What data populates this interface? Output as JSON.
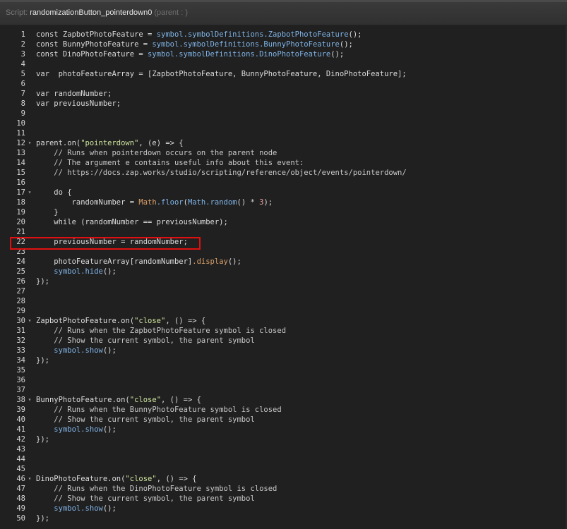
{
  "header": {
    "label": "Script:",
    "name": "randomizationButton_pointerdown0",
    "parent": "(parent : )"
  },
  "lines": [
    {
      "n": "1",
      "t": "const ZapbotPhotoFeature = symbol.symbolDefinitions.ZapbotPhotoFeature();"
    },
    {
      "n": "2",
      "t": "const BunnyPhotoFeature = symbol.symbolDefinitions.BunnyPhotoFeature();"
    },
    {
      "n": "3",
      "t": "const DinoPhotoFeature = symbol.symbolDefinitions.DinoPhotoFeature();"
    },
    {
      "n": "4",
      "t": ""
    },
    {
      "n": "5",
      "t": "var  photoFeatureArray = [ZapbotPhotoFeature, BunnyPhotoFeature, DinoPhotoFeature];"
    },
    {
      "n": "6",
      "t": ""
    },
    {
      "n": "7",
      "t": "var randomNumber;"
    },
    {
      "n": "8",
      "t": "var previousNumber;"
    },
    {
      "n": "9",
      "t": ""
    },
    {
      "n": "10",
      "t": ""
    },
    {
      "n": "11",
      "t": ""
    },
    {
      "n": "12",
      "t": "parent.on(\"pointerdown\", (e) => {"
    },
    {
      "n": "13",
      "t": "    // Runs when pointerdown occurs on the parent node"
    },
    {
      "n": "14",
      "t": "    // The argument e contains useful info about this event:"
    },
    {
      "n": "15",
      "t": "    // https://docs.zap.works/studio/scripting/reference/object/events/pointerdown/"
    },
    {
      "n": "16",
      "t": ""
    },
    {
      "n": "17",
      "t": "    do {"
    },
    {
      "n": "18",
      "t": "        randomNumber = Math.floor(Math.random() * 3);"
    },
    {
      "n": "19",
      "t": "    }"
    },
    {
      "n": "20",
      "t": "    while (randomNumber == previousNumber);"
    },
    {
      "n": "21",
      "t": ""
    },
    {
      "n": "22",
      "t": "    previousNumber = randomNumber;"
    },
    {
      "n": "23",
      "t": ""
    },
    {
      "n": "24",
      "t": "    photoFeatureArray[randomNumber].display();"
    },
    {
      "n": "25",
      "t": "    symbol.hide();"
    },
    {
      "n": "26",
      "t": "});"
    },
    {
      "n": "27",
      "t": ""
    },
    {
      "n": "28",
      "t": ""
    },
    {
      "n": "29",
      "t": ""
    },
    {
      "n": "30",
      "t": "ZapbotPhotoFeature.on(\"close\", () => {"
    },
    {
      "n": "31",
      "t": "    // Runs when the ZapbotPhotoFeature symbol is closed"
    },
    {
      "n": "32",
      "t": "    // Show the current symbol, the parent symbol"
    },
    {
      "n": "33",
      "t": "    symbol.show();"
    },
    {
      "n": "34",
      "t": "});"
    },
    {
      "n": "35",
      "t": ""
    },
    {
      "n": "36",
      "t": ""
    },
    {
      "n": "37",
      "t": ""
    },
    {
      "n": "38",
      "t": "BunnyPhotoFeature.on(\"close\", () => {"
    },
    {
      "n": "39",
      "t": "    // Runs when the BunnyPhotoFeature symbol is closed"
    },
    {
      "n": "40",
      "t": "    // Show the current symbol, the parent symbol"
    },
    {
      "n": "41",
      "t": "    symbol.show();"
    },
    {
      "n": "42",
      "t": "});"
    },
    {
      "n": "43",
      "t": ""
    },
    {
      "n": "44",
      "t": ""
    },
    {
      "n": "45",
      "t": ""
    },
    {
      "n": "46",
      "t": "DinoPhotoFeature.on(\"close\", () => {"
    },
    {
      "n": "47",
      "t": "    // Runs when the DinoPhotoFeature symbol is closed"
    },
    {
      "n": "48",
      "t": "    // Show the current symbol, the parent symbol"
    },
    {
      "n": "49",
      "t": "    symbol.show();"
    },
    {
      "n": "50",
      "t": "});"
    }
  ],
  "fold_lines": [
    "12",
    "17",
    "30",
    "38",
    "46"
  ],
  "fold_icon": "chevron-down-icon",
  "highlight_line": "22",
  "colors": {
    "highlight_border": "#e01010",
    "background": "#202020",
    "symbol_blue": "#7fb3e6",
    "string_green": "#cfe6a0",
    "number_pink": "#f0a0a0",
    "function_orange": "#d9a06a"
  }
}
